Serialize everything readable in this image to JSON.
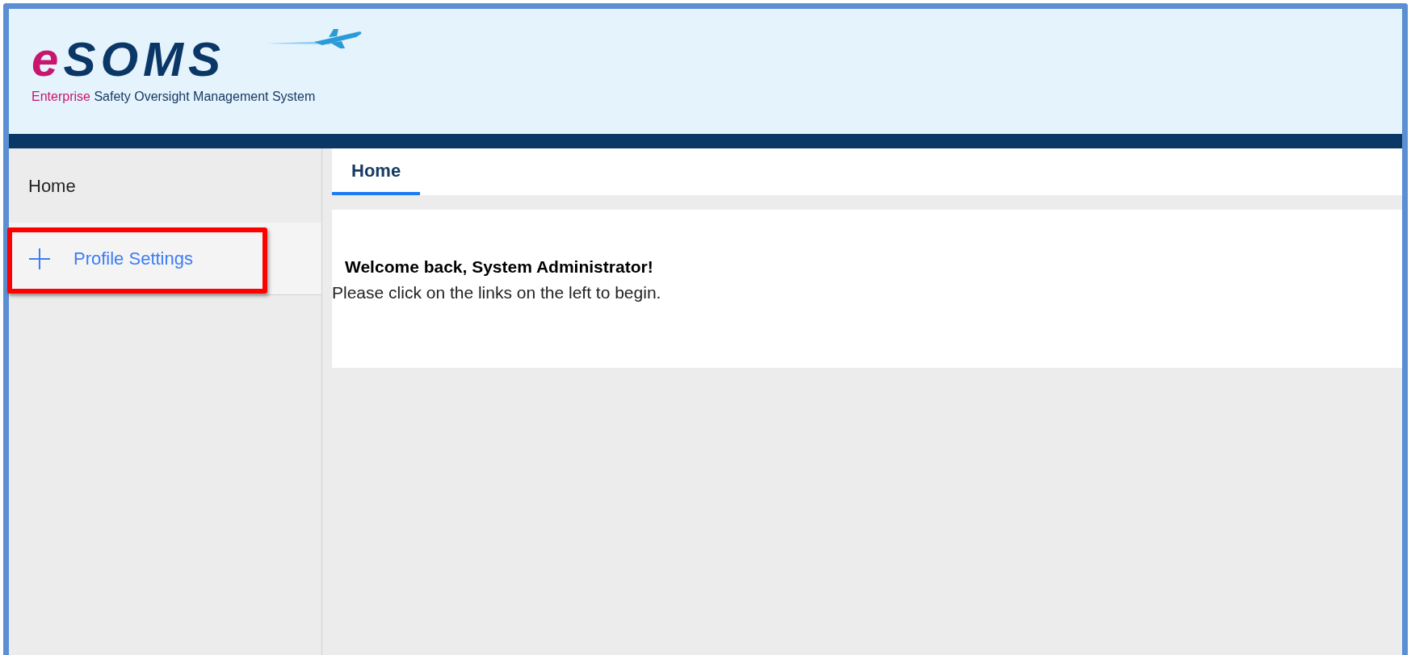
{
  "logo": {
    "prefix": "e",
    "name": "SOMS",
    "tagline_accent": "Enterprise",
    "tagline": "Safety Oversight Management System"
  },
  "sidebar": {
    "items": [
      {
        "label": "Home",
        "kind": "link",
        "highlighted": false
      },
      {
        "label": "Profile Settings",
        "kind": "expandable",
        "highlighted": true
      }
    ]
  },
  "tabs": [
    {
      "label": "Home",
      "selected": true
    }
  ],
  "welcome": {
    "title": "Welcome back, System Administrator!",
    "text": "Please click on the links on the left to begin."
  }
}
